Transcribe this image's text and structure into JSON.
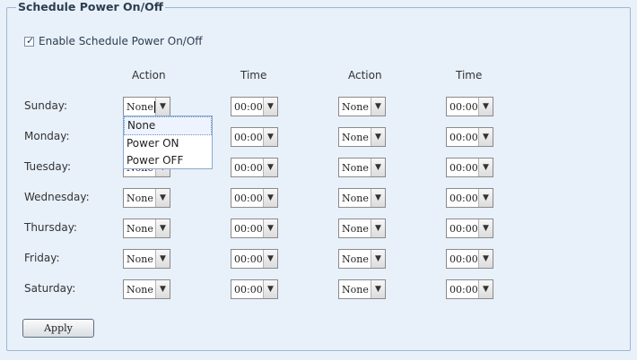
{
  "panel": {
    "title": "Schedule Power On/Off",
    "enable_label": "Enable Schedule Power On/Off",
    "enable_checked": true
  },
  "headers": [
    "Action",
    "Time",
    "Action",
    "Time"
  ],
  "days": [
    {
      "label": "Sunday:",
      "action1": "None",
      "time1": "00:00",
      "action2": "None",
      "time2": "00:00"
    },
    {
      "label": "Monday:",
      "action1": "None",
      "time1": "00:00",
      "action2": "None",
      "time2": "00:00"
    },
    {
      "label": "Tuesday:",
      "action1": "None",
      "time1": "00:00",
      "action2": "None",
      "time2": "00:00"
    },
    {
      "label": "Wednesday:",
      "action1": "None",
      "time1": "00:00",
      "action2": "None",
      "time2": "00:00"
    },
    {
      "label": "Thursday:",
      "action1": "None",
      "time1": "00:00",
      "action2": "None",
      "time2": "00:00"
    },
    {
      "label": "Friday:",
      "action1": "None",
      "time1": "00:00",
      "action2": "None",
      "time2": "00:00"
    },
    {
      "label": "Saturday:",
      "action1": "None",
      "time1": "00:00",
      "action2": "None",
      "time2": "00:00"
    }
  ],
  "dropdown_options": [
    "None",
    "Power ON",
    "Power OFF"
  ],
  "apply_label": "Apply",
  "icons": {
    "checkbox_check": "check-icon",
    "select_arrow": "chevron-down-icon"
  }
}
